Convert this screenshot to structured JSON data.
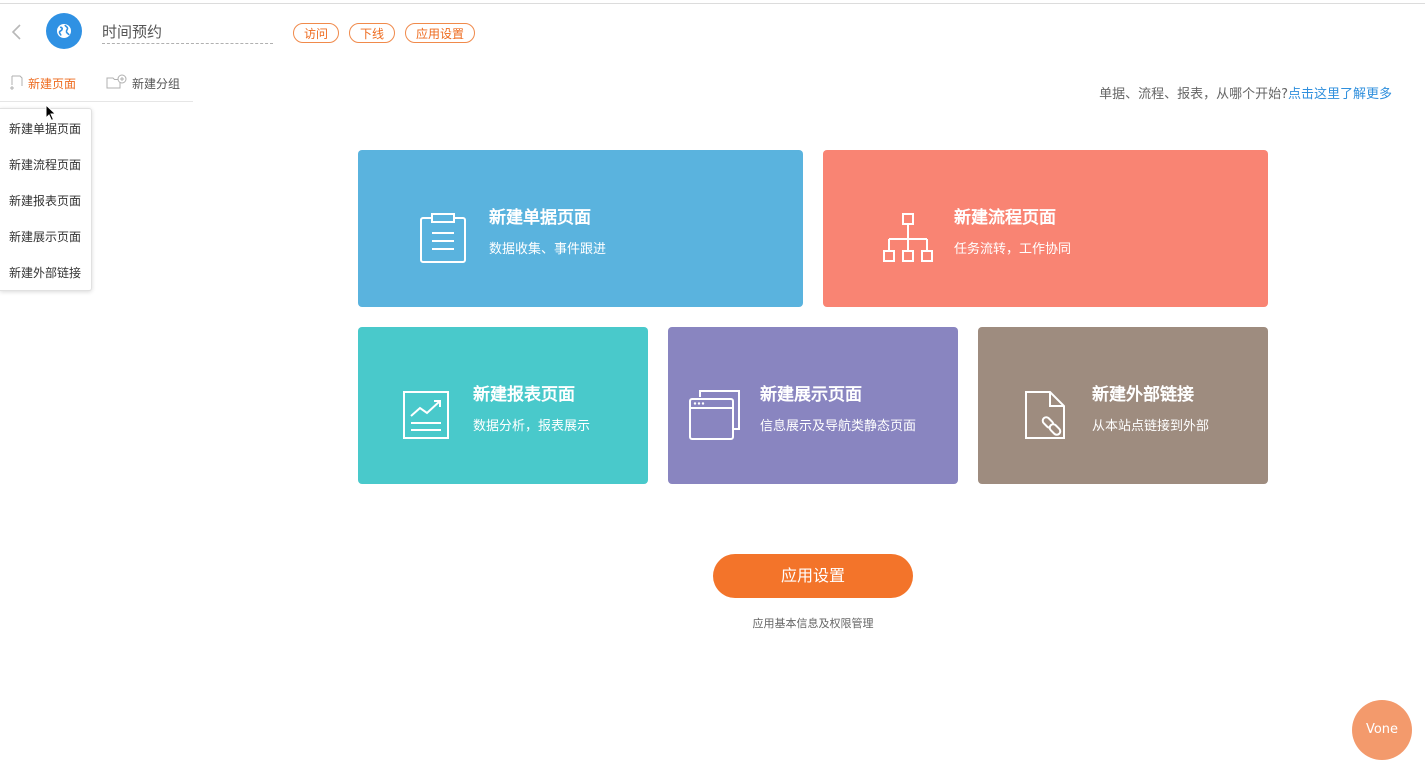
{
  "header": {
    "app_title": "时间预约",
    "buttons": {
      "visit": "访问",
      "offline": "下线",
      "settings": "应用设置"
    }
  },
  "nav": {
    "new_page": "新建页面",
    "new_group": "新建分组"
  },
  "dropdown": {
    "items": [
      "新建单据页面",
      "新建流程页面",
      "新建报表页面",
      "新建展示页面",
      "新建外部链接"
    ]
  },
  "help": {
    "text": "单据、流程、报表，从哪个开始?",
    "link": "点击这里了解更多"
  },
  "cards": [
    {
      "title": "新建单据页面",
      "subtitle": "数据收集、事件跟进",
      "icon": "clipboard-icon",
      "color": "#5ab3de"
    },
    {
      "title": "新建流程页面",
      "subtitle": "任务流转，工作协同",
      "icon": "flowchart-icon",
      "color": "#f98473"
    },
    {
      "title": "新建报表页面",
      "subtitle": "数据分析，报表展示",
      "icon": "chart-icon",
      "color": "#49c9cb"
    },
    {
      "title": "新建展示页面",
      "subtitle": "信息展示及导航类静态页面",
      "icon": "windows-icon",
      "color": "#8985c0"
    },
    {
      "title": "新建外部链接",
      "subtitle": "从本站点链接到外部",
      "icon": "file-link-icon",
      "color": "#9e8c7f"
    }
  ],
  "settings": {
    "button": "应用设置",
    "subtitle": "应用基本信息及权限管理"
  },
  "vone": "Vone",
  "colors": {
    "accent": "#f3742a",
    "link": "#2f8fdd",
    "app_icon": "#2f91e3"
  }
}
